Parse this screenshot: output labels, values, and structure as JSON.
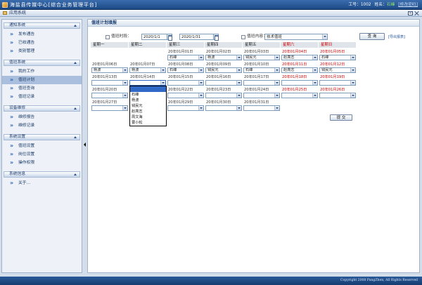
{
  "app": {
    "title": "海盐县传媒中心[综合业务管理平台]",
    "user_id_label": "工号：",
    "user_id": "1002",
    "user_name_label": "姓名：",
    "user_name": "石峰",
    "change_password_link": "[修改密码]"
  },
  "subbar": {
    "title": "应用系统"
  },
  "sidebar": {
    "sections": [
      {
        "title": "通知系统",
        "items": [
          {
            "label": "发布通告"
          },
          {
            "label": "已收通告"
          },
          {
            "label": "类别管理"
          }
        ]
      },
      {
        "title": "值班系统",
        "items": [
          {
            "label": "我的工作"
          },
          {
            "label": "值班计划",
            "selected": true
          },
          {
            "label": "值班查询"
          },
          {
            "label": "值班记录"
          }
        ]
      },
      {
        "title": "设备维修",
        "items": [
          {
            "label": "维修报告"
          },
          {
            "label": "维修记录"
          }
        ]
      },
      {
        "title": "系统设置",
        "items": [
          {
            "label": "值班设置"
          },
          {
            "label": "岗位设置"
          },
          {
            "label": "操作权限"
          }
        ]
      },
      {
        "title": "系统信息",
        "items": [
          {
            "label": "关于…"
          }
        ]
      }
    ]
  },
  "main": {
    "title": "值班计划填报",
    "filter": {
      "time_checked": false,
      "time_label": "值班时段：",
      "start_date": "2020/1/1",
      "end_date": "2020/1/31",
      "content_checked": false,
      "content_label": "值班内容：",
      "content_value": "技术值班",
      "query_button": "查 询",
      "export_link": "[导出报表]"
    },
    "calendar": {
      "headers": [
        {
          "label": "星期一",
          "weekend": false
        },
        {
          "label": "星期二",
          "weekend": false
        },
        {
          "label": "星期三",
          "weekend": false
        },
        {
          "label": "星期四",
          "weekend": false
        },
        {
          "label": "星期五",
          "weekend": false
        },
        {
          "label": "星期六",
          "weekend": true
        },
        {
          "label": "星期日",
          "weekend": true
        }
      ],
      "options": [
        "",
        "石峰",
        "杨波",
        "钱民元",
        "赵亮志",
        "周文海",
        "曹小松"
      ],
      "weeks": [
        [
          null,
          null,
          {
            "date": "20年01月01日",
            "value": "石峰"
          },
          {
            "date": "20年01月02日",
            "value": "杨波"
          },
          {
            "date": "20年01月03日",
            "value": "钱民元"
          },
          {
            "date": "20年01月04日",
            "value": "赵亮志"
          },
          {
            "date": "20年01月05日",
            "value": "石峰"
          }
        ],
        [
          {
            "date": "20年01月06日",
            "value": "杨波"
          },
          {
            "date": "20年01月07日",
            "value": "杨波"
          },
          {
            "date": "20年01月08日",
            "value": "石峰"
          },
          {
            "date": "20年01月09日",
            "value": "钱民元"
          },
          {
            "date": "20年01月10日",
            "value": "石峰"
          },
          {
            "date": "20年01月11日",
            "value": "赵亮志"
          },
          {
            "date": "20年01月12日",
            "value": "钱民元"
          }
        ],
        [
          {
            "date": "20年01月13日",
            "value": ""
          },
          {
            "date": "20年01月14日",
            "value": "",
            "open": true,
            "highlighted_option": 0
          },
          {
            "date": "20年01月15日",
            "value": ""
          },
          {
            "date": "20年01月16日",
            "value": ""
          },
          {
            "date": "20年01月17日",
            "value": ""
          },
          {
            "date": "20年01月18日",
            "value": ""
          },
          {
            "date": "20年01月19日",
            "value": ""
          }
        ],
        [
          {
            "date": "20年01月20日",
            "value": ""
          },
          {},
          {
            "date": "20年01月22日",
            "value": ""
          },
          {
            "date": "20年01月23日",
            "value": ""
          },
          {
            "date": "20年01月24日",
            "value": ""
          },
          {
            "date": "20年01月25日",
            "value": ""
          },
          {
            "date": "20年01月26日",
            "value": ""
          }
        ],
        [
          {
            "date": "20年01月27日",
            "value": ""
          },
          {},
          {
            "date": "20年01月29日",
            "value": ""
          },
          {
            "date": "20年01月30日",
            "value": ""
          },
          {
            "date": "20年01月31日",
            "value": ""
          },
          null,
          null
        ]
      ]
    },
    "submit_button": "提 交"
  },
  "footer": {
    "copyright": "Copyright 2008 PangZhen, All Rights Reserved"
  },
  "icons": {
    "app": "app-logo-icon",
    "subbar": "folder-icon",
    "window_buttons": [
      "restore-icon",
      "close-icon"
    ],
    "sidebar_item": "double-chevron-right-icon",
    "section_toggle": "collapse-up-icon",
    "date_picker": "calendar-icon",
    "select_arrow": "dropdown-arrow-icon",
    "splitter": "collapse-left-arrow-icon"
  },
  "colors": {
    "title_bar": "#1d4a86",
    "weekend": "#cc0000",
    "selected_item": "#a9bfdd",
    "link": "#2c5aa0",
    "user_name": "#8ce06a",
    "option_highlight": "#3169c6",
    "footer": "#163c70"
  }
}
